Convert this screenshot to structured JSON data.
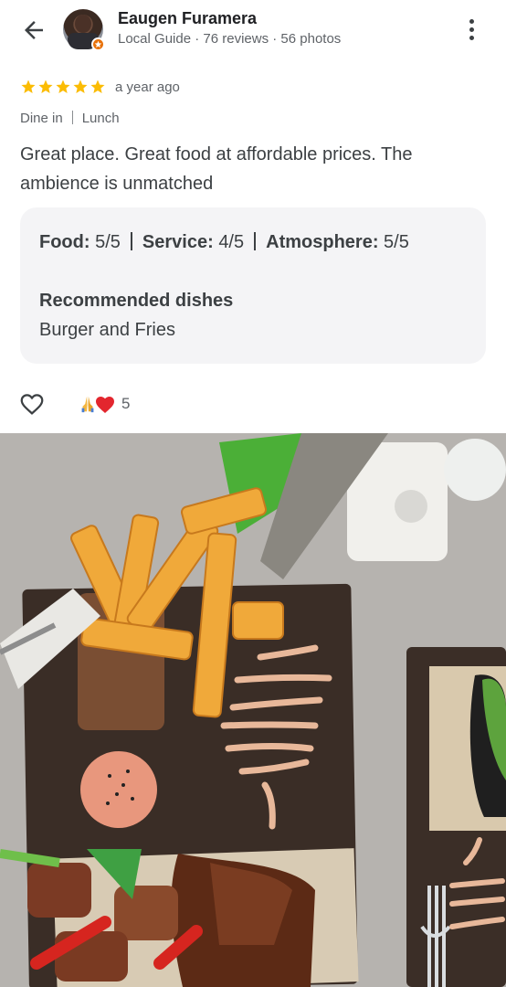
{
  "header": {
    "reviewer_name": "Eaugen Furamera",
    "reviewer_meta": "Local Guide · 76 reviews · 56 photos",
    "back_icon": "arrow-left-icon",
    "menu_icon": "more-vert-icon"
  },
  "review": {
    "stars": 5,
    "time_ago": "a year ago",
    "tag_dine": "Dine in",
    "tag_meal": "Lunch",
    "text": "Great place. Great food at affordable prices. The ambience is unmatched"
  },
  "details": {
    "food_label": "Food:",
    "food_value": "5/5",
    "service_label": "Service:",
    "service_value": "4/5",
    "atmosphere_label": "Atmosphere:",
    "atmosphere_value": "5/5",
    "recommended_title": "Recommended dishes",
    "recommended_value": "Burger and Fries"
  },
  "actions": {
    "like_icon": "heart-outline-icon",
    "reaction_icons": [
      "folded-hands-emoji",
      "red-heart-emoji"
    ],
    "reaction_count": "5"
  },
  "colors": {
    "star": "#fbbc04",
    "card_bg": "#f4f4f6",
    "guide_badge": "#e8710a"
  }
}
